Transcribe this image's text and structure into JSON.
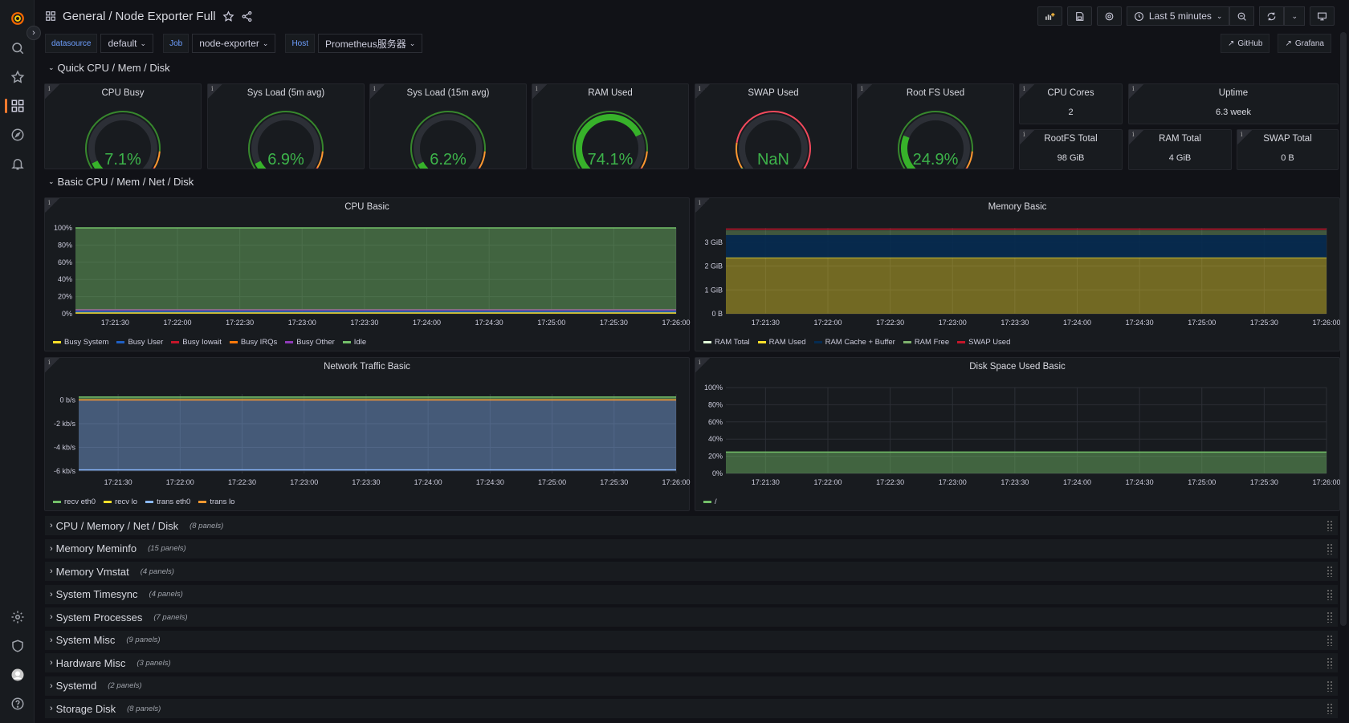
{
  "nav": {
    "top_icons": [
      "grafana-logo-icon",
      "search-icon",
      "star-icon",
      "dashboards-icon",
      "explore-icon",
      "alerting-icon"
    ],
    "bottom_icons": [
      "gear-icon",
      "shield-icon",
      "avatar",
      "help-icon"
    ]
  },
  "header": {
    "folder": "General",
    "separator": "/",
    "title": "Node Exporter Full",
    "time_range": "Last 5 minutes"
  },
  "variables": [
    {
      "label": "datasource",
      "value": "default"
    },
    {
      "label": "Job",
      "value": "node-exporter"
    },
    {
      "label": "Host",
      "value": "Prometheus服务器"
    }
  ],
  "links": [
    {
      "label": "GitHub"
    },
    {
      "label": "Grafana"
    }
  ],
  "rows": {
    "quick": "Quick CPU / Mem / Disk",
    "basic": "Basic CPU / Mem / Net / Disk"
  },
  "gauges": [
    {
      "title": "CPU Busy",
      "value": "7.1%",
      "fraction": 0.071
    },
    {
      "title": "Sys Load (5m avg)",
      "value": "6.9%",
      "fraction": 0.069
    },
    {
      "title": "Sys Load (15m avg)",
      "value": "6.2%",
      "fraction": 0.062
    },
    {
      "title": "RAM Used",
      "value": "74.1%",
      "fraction": 0.741
    },
    {
      "title": "SWAP Used",
      "value": "NaN",
      "fraction": 0
    },
    {
      "title": "Root FS Used",
      "value": "24.9%",
      "fraction": 0.249
    }
  ],
  "stats": [
    {
      "title": "CPU Cores",
      "value": "2"
    },
    {
      "title": "Uptime",
      "value": "6.3 week"
    },
    {
      "title": "RootFS Total",
      "value": "98 GiB"
    },
    {
      "title": "RAM Total",
      "value": "4 GiB"
    },
    {
      "title": "SWAP Total",
      "value": "0 B"
    }
  ],
  "chart_data": [
    {
      "type": "area",
      "title": "CPU Basic",
      "x": [
        "17:21:30",
        "17:22:00",
        "17:22:30",
        "17:23:00",
        "17:23:30",
        "17:24:00",
        "17:24:30",
        "17:25:00",
        "17:25:30",
        "17:26:00"
      ],
      "yticks": [
        "0%",
        "20%",
        "40%",
        "60%",
        "80%",
        "100%"
      ],
      "ylim": [
        0,
        100
      ],
      "series": [
        {
          "name": "Busy System",
          "color": "#fade2a",
          "value": 1.5
        },
        {
          "name": "Busy User",
          "color": "#1f60c4",
          "value": 2.5
        },
        {
          "name": "Busy Iowait",
          "color": "#c4162a",
          "value": 0.5
        },
        {
          "name": "Busy IRQs",
          "color": "#ff780a",
          "value": 0.1
        },
        {
          "name": "Busy Other",
          "color": "#8f3bb8",
          "value": 0.1
        },
        {
          "name": "Idle",
          "color": "#73bf69",
          "value": 95.3
        }
      ]
    },
    {
      "type": "area",
      "title": "Memory Basic",
      "x": [
        "17:21:30",
        "17:22:00",
        "17:22:30",
        "17:23:00",
        "17:23:30",
        "17:24:00",
        "17:24:30",
        "17:25:00",
        "17:25:30",
        "17:26:00"
      ],
      "yticks": [
        "0 B",
        "1 GiB",
        "2 GiB",
        "3 GiB"
      ],
      "ylim": [
        0,
        3.6
      ],
      "series": [
        {
          "name": "RAM Total",
          "color": "#e0f9d7",
          "value": 3.55
        },
        {
          "name": "RAM Used",
          "color": "#fade2a",
          "value": 2.35
        },
        {
          "name": "RAM Cache + Buffer",
          "color": "#052b51",
          "value": 0.95
        },
        {
          "name": "RAM Free",
          "color": "#7eb26d",
          "value": 0.2
        },
        {
          "name": "SWAP Used",
          "color": "#c4162a",
          "value": 0
        }
      ]
    },
    {
      "type": "area",
      "title": "Network Traffic Basic",
      "x": [
        "17:21:30",
        "17:22:00",
        "17:22:30",
        "17:23:00",
        "17:23:30",
        "17:24:00",
        "17:24:30",
        "17:25:00",
        "17:25:30",
        "17:26:00"
      ],
      "yticks": [
        "0 b/s",
        "-2 kb/s",
        "-4 kb/s",
        "-6 kb/s"
      ],
      "ylim": [
        -6.2,
        0.5
      ],
      "series": [
        {
          "name": "recv eth0",
          "color": "#73bf69",
          "value": 0.25
        },
        {
          "name": "recv lo",
          "color": "#fade2a",
          "value": 0.05
        },
        {
          "name": "trans eth0",
          "color": "#8ab8ff",
          "value": -5.9
        },
        {
          "name": "trans lo",
          "color": "#ff9830",
          "value": -0.05
        }
      ]
    },
    {
      "type": "area",
      "title": "Disk Space Used Basic",
      "x": [
        "17:21:30",
        "17:22:00",
        "17:22:30",
        "17:23:00",
        "17:23:30",
        "17:24:00",
        "17:24:30",
        "17:25:00",
        "17:25:30",
        "17:26:00"
      ],
      "yticks": [
        "0%",
        "20%",
        "40%",
        "60%",
        "80%",
        "100%"
      ],
      "ylim": [
        0,
        100
      ],
      "series": [
        {
          "name": "/",
          "color": "#73bf69",
          "value": 24.9
        }
      ]
    }
  ],
  "collapsed_rows": [
    {
      "title": "CPU / Memory / Net / Disk",
      "count": "(8 panels)"
    },
    {
      "title": "Memory Meminfo",
      "count": "(15 panels)"
    },
    {
      "title": "Memory Vmstat",
      "count": "(4 panels)"
    },
    {
      "title": "System Timesync",
      "count": "(4 panels)"
    },
    {
      "title": "System Processes",
      "count": "(7 panels)"
    },
    {
      "title": "System Misc",
      "count": "(9 panels)"
    },
    {
      "title": "Hardware Misc",
      "count": "(3 panels)"
    },
    {
      "title": "Systemd",
      "count": "(2 panels)"
    },
    {
      "title": "Storage Disk",
      "count": "(8 panels)"
    }
  ]
}
